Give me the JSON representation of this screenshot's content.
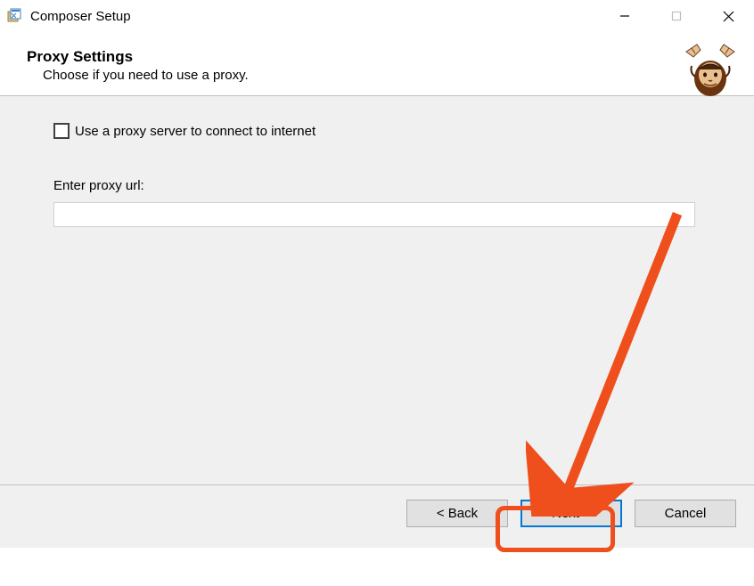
{
  "window": {
    "title": "Composer Setup"
  },
  "header": {
    "title": "Proxy Settings",
    "subtitle": "Choose if you need to use a proxy."
  },
  "content": {
    "checkbox_label": "Use a proxy server to connect to internet",
    "url_label": "Enter proxy url:",
    "url_value": ""
  },
  "footer": {
    "back_label": "< Back",
    "next_label": "Next >",
    "cancel_label": "Cancel"
  }
}
